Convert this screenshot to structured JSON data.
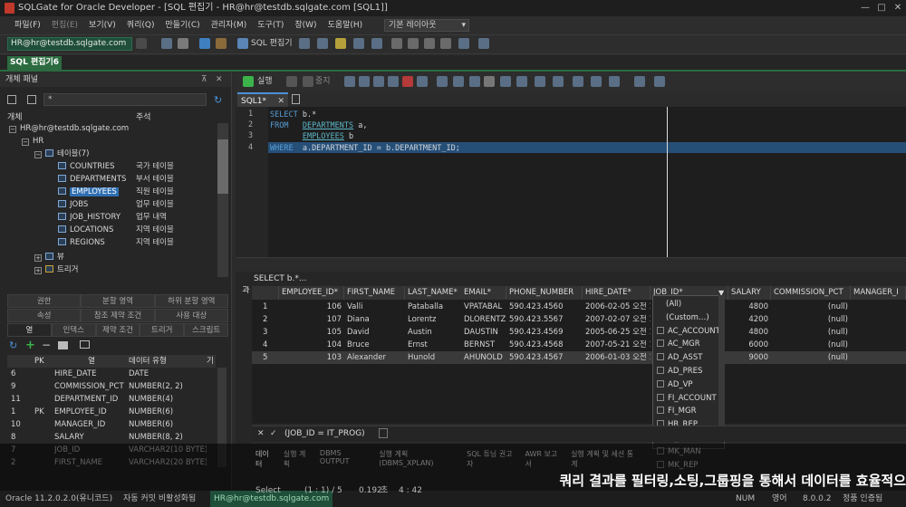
{
  "window": {
    "title": "SQLGate for Oracle Developer - [SQL 편집기 - HR@hr@testdb.sqlgate.com [SQL1]]"
  },
  "menu": {
    "items": [
      "파일(F)",
      "편집(E)",
      "보기(V)",
      "쿼리(Q)",
      "만들기(C)",
      "관리자(M)",
      "도구(T)",
      "창(W)",
      "도움말(H)"
    ],
    "layout": "기본 레이아웃"
  },
  "toolbar": {
    "connection": "HR@hr@testdb.sqlgate.com",
    "sql_editor": "SQL 편집기"
  },
  "doc_tab": "SQL 편집기6",
  "object_panel": {
    "title": "개체 패널",
    "col_object": "개체",
    "col_comment": "주석",
    "tree": [
      {
        "label": "HR@hr@testdb.sqlgate.com",
        "comment": ""
      },
      {
        "label": "HR",
        "comment": ""
      },
      {
        "label": "테이블(7)",
        "comment": ""
      },
      {
        "label": "COUNTRIES",
        "comment": "국가 테이블"
      },
      {
        "label": "DEPARTMENTS",
        "comment": "부서 테이블"
      },
      {
        "label": "EMPLOYEES",
        "comment": "직원 테이블"
      },
      {
        "label": "JOBS",
        "comment": "업무 테이블"
      },
      {
        "label": "JOB_HISTORY",
        "comment": "업무 내역"
      },
      {
        "label": "LOCATIONS",
        "comment": "지역 테이블"
      },
      {
        "label": "REGIONS",
        "comment": "지역 테이블"
      },
      {
        "label": "뷰",
        "comment": ""
      },
      {
        "label": "트리거",
        "comment": ""
      }
    ]
  },
  "detail_tabs": {
    "row1": [
      "권한",
      "분할 영역",
      "하위 분할 영역"
    ],
    "row2": [
      "속성",
      "참조 제약 조건",
      "사용 대상"
    ],
    "row3": [
      "열",
      "인덱스",
      "제약 조건",
      "트리거",
      "스크립트"
    ]
  },
  "columns_grid": {
    "headers": [
      "PK",
      "열",
      "데이터 유형",
      "기"
    ],
    "rows": [
      {
        "n": "6",
        "pk": "",
        "col": "HIRE_DATE",
        "type": "DATE"
      },
      {
        "n": "9",
        "pk": "",
        "col": "COMMISSION_PCT",
        "type": "NUMBER(2, 2)"
      },
      {
        "n": "11",
        "pk": "",
        "col": "DEPARTMENT_ID",
        "type": "NUMBER(4)"
      },
      {
        "n": "1",
        "pk": "PK",
        "col": "EMPLOYEE_ID",
        "type": "NUMBER(6)"
      },
      {
        "n": "10",
        "pk": "",
        "col": "MANAGER_ID",
        "type": "NUMBER(6)"
      },
      {
        "n": "8",
        "pk": "",
        "col": "SALARY",
        "type": "NUMBER(8, 2)"
      },
      {
        "n": "7",
        "pk": "",
        "col": "JOB_ID",
        "type": "VARCHAR2(10 BYTE)"
      },
      {
        "n": "2",
        "pk": "",
        "col": "FIRST_NAME",
        "type": "VARCHAR2(20 BYTE)"
      }
    ]
  },
  "editor": {
    "toolbar_run": "실행",
    "toolbar_stop": "중지",
    "tab": "SQL1*",
    "lines": [
      {
        "n": "1",
        "kw": "SELECT",
        "rest": " b.*"
      },
      {
        "n": "2",
        "kw": "FROM",
        "tbl": "DEPARTMENTS",
        "rest": " a,"
      },
      {
        "n": "3",
        "kw": "",
        "tbl": "EMPLOYEES",
        "rest": " b"
      },
      {
        "n": "4",
        "kw": "WHERE",
        "rest": "  a.DEPARTMENT_ID = b.DEPARTMENT_ID;"
      }
    ]
  },
  "result": {
    "side_label": "결과",
    "query": "SELECT b.*...",
    "headers": [
      "EMPLOYEE_ID*",
      "FIRST_NAME",
      "LAST_NAME*",
      "EMAIL*",
      "PHONE_NUMBER",
      "HIRE_DATE*",
      "JOB_ID*",
      "SALARY",
      "COMMISSION_PCT",
      "MANAGER_I"
    ],
    "rows": [
      {
        "n": "1",
        "id": "106",
        "first": "Valli",
        "last": "Pataballa",
        "email": "VPATABAL",
        "phone": "590.423.4560",
        "hire": "2006-02-05 오전 12",
        "salary": "4800",
        "comm": "(null)"
      },
      {
        "n": "2",
        "id": "107",
        "first": "Diana",
        "last": "Lorentz",
        "email": "DLORENTZ",
        "phone": "590.423.5567",
        "hire": "2007-02-07 오전 12",
        "salary": "4200",
        "comm": "(null)"
      },
      {
        "n": "3",
        "id": "105",
        "first": "David",
        "last": "Austin",
        "email": "DAUSTIN",
        "phone": "590.423.4569",
        "hire": "2005-06-25 오전 12",
        "salary": "4800",
        "comm": "(null)"
      },
      {
        "n": "4",
        "id": "104",
        "first": "Bruce",
        "last": "Ernst",
        "email": "BERNST",
        "phone": "590.423.4568",
        "hire": "2007-05-21 오전 12",
        "salary": "6000",
        "comm": "(null)"
      },
      {
        "n": "5",
        "id": "103",
        "first": "Alexander",
        "last": "Hunold",
        "email": "AHUNOLD",
        "phone": "590.423.4567",
        "hire": "2006-01-03 오전 12",
        "salary": "9000",
        "comm": "(null)"
      }
    ],
    "filter_text": "(JOB_ID = IT_PROG)",
    "bottom_tabs": [
      "데이터",
      "실행 계획",
      "DBMS OUTPUT",
      "실행 계획(DBMS_XPLAN)",
      "SQL 튜닝 권고자",
      "AWR 보고서",
      "실행 계획 및 세션 통계"
    ]
  },
  "filter_popup": {
    "items": [
      {
        "label": "(All)",
        "check": false,
        "box": false
      },
      {
        "label": "(Custom…)",
        "check": false,
        "box": false
      },
      {
        "label": "AC_ACCOUNT",
        "check": false,
        "box": true
      },
      {
        "label": "AC_MGR",
        "check": false,
        "box": true
      },
      {
        "label": "AD_ASST",
        "check": false,
        "box": true
      },
      {
        "label": "AD_PRES",
        "check": false,
        "box": true
      },
      {
        "label": "AD_VP",
        "check": false,
        "box": true
      },
      {
        "label": "FI_ACCOUNT",
        "check": false,
        "box": true
      },
      {
        "label": "FI_MGR",
        "check": false,
        "box": true
      },
      {
        "label": "HR_REP",
        "check": false,
        "box": true
      },
      {
        "label": "IT_PROG",
        "check": true,
        "box": true
      },
      {
        "label": "MK_MAN",
        "check": false,
        "box": true
      },
      {
        "label": "MK_REP",
        "check": false,
        "box": true
      }
    ]
  },
  "subtitle": "쿼리 결과를 필터링,소팅,그룹핑을 통해서 데이터를 효율적으",
  "status": {
    "left": "Oracle 11.2.0.2.0(유니코드)",
    "autocommit": "자동 커밋 비활성화됨",
    "conn": "HR@hr@testdb.sqlgate.com",
    "select": "Select",
    "pos": "(1 : 1) / 5",
    "time": "0.192",
    "time_unit": "초",
    "cursor": "4 : 42",
    "num": "NUM",
    "lang": "영어",
    "ver": "8.0.0.2",
    "license": "정품 인증됨"
  }
}
